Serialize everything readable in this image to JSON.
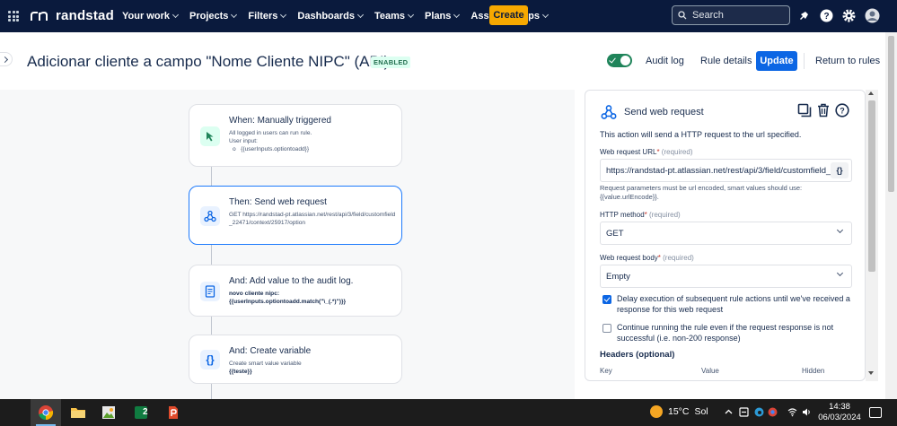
{
  "topbar": {
    "logo_text": "randstad",
    "nav": [
      "Your work",
      "Projects",
      "Filters",
      "Dashboards",
      "Teams",
      "Plans",
      "Assets",
      "Apps"
    ],
    "nav_has_chevron": [
      true,
      true,
      true,
      true,
      true,
      true,
      false,
      true
    ],
    "create_label": "Create",
    "search_placeholder": "Search"
  },
  "header": {
    "title": "Adicionar cliente a campo \"Nome Cliente NIPC\" (API)",
    "status_badge": "ENABLED",
    "audit_log": "Audit log",
    "rule_details": "Rule details",
    "update": "Update",
    "return_to_rules": "Return to rules"
  },
  "flow": {
    "trigger": {
      "title": "When: Manually triggered",
      "line1": "All logged in users can run rule.",
      "line2": "User input:",
      "line3": "{{userInputs.optiontoadd}}"
    },
    "web_request": {
      "title": "Then: Send web request",
      "body": "GET https://randstad-pt.atlassian.net/rest/api/3/field/customfield_22471/context/25917/option"
    },
    "audit": {
      "title": "And: Add value to the audit log.",
      "line1": "novo cliente nipc:",
      "line2": "{{userInputs.optiontoadd.match(\"\\_(.*)\")}}"
    },
    "variable": {
      "title": "And: Create variable",
      "line1": "Create smart value variable",
      "line2": "{{teste}}"
    }
  },
  "panel": {
    "title": "Send web request",
    "description": "This action will send a HTTP request to the url specified.",
    "url_label": "Web request URL",
    "required": "(required)",
    "url_value": "https://randstad-pt.atlassian.net/rest/api/3/field/customfield_",
    "smart_value_button": "{}",
    "url_help": "Request parameters must be url encoded, smart values should use: {{value.urlEncode}}.",
    "method_label": "HTTP method",
    "method_value": "GET",
    "body_label": "Web request body",
    "body_value": "Empty",
    "delay_text": "Delay execution of subsequent rule actions until we've received a response for this web request",
    "delay_checked": true,
    "continue_text": "Continue running the rule even if the request response is not successful (i.e. non-200 response)",
    "continue_checked": false,
    "headers_title": "Headers (optional)",
    "headers_cols": [
      "Key",
      "Value",
      "Hidden"
    ]
  },
  "taskbar": {
    "temperature": "15°C",
    "weather": "Sol",
    "time": "14:38",
    "date": "06/03/2024",
    "app_badge": "2"
  },
  "colors": {
    "topbar_bg": "#0a1a3d",
    "create_bg": "#f6a800",
    "primary": "#0c66e4",
    "enabled_green": "#1f845a"
  }
}
